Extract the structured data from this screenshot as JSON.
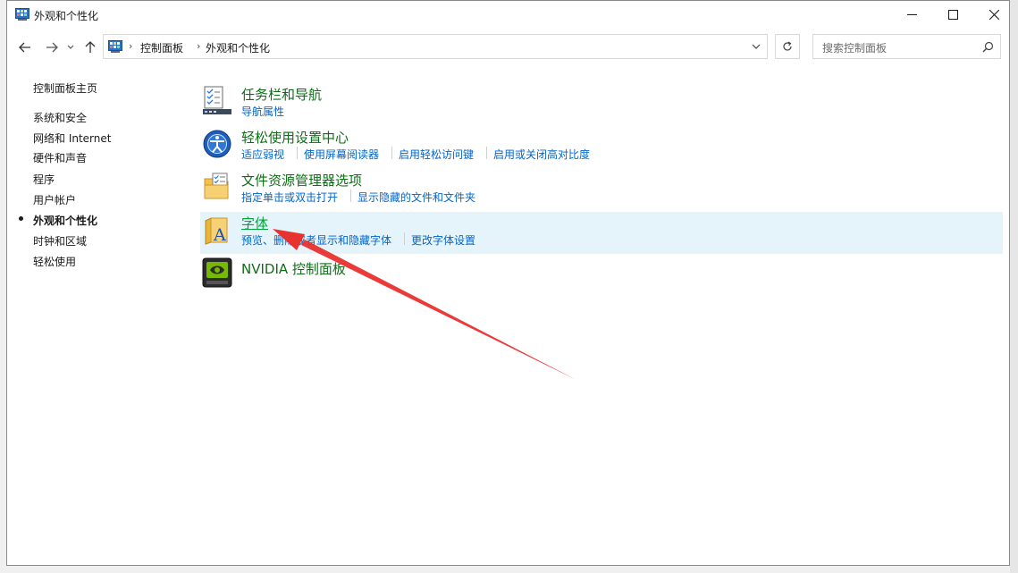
{
  "window": {
    "title": "外观和个性化",
    "controls": {
      "minimize": "minimize",
      "maximize": "maximize",
      "close": "close"
    }
  },
  "address": {
    "segments": [
      "控制面板",
      "外观和个性化"
    ]
  },
  "search": {
    "placeholder": "搜索控制面板"
  },
  "sidebar": {
    "home": "控制面板主页",
    "items": [
      {
        "label": "系统和安全",
        "active": false
      },
      {
        "label": "网络和 Internet",
        "active": false
      },
      {
        "label": "硬件和声音",
        "active": false
      },
      {
        "label": "程序",
        "active": false
      },
      {
        "label": "用户帐户",
        "active": false
      },
      {
        "label": "外观和个性化",
        "active": true
      },
      {
        "label": "时钟和区域",
        "active": false
      },
      {
        "label": "轻松使用",
        "active": false
      }
    ]
  },
  "categories": [
    {
      "title": "任务栏和导航",
      "icon": "taskbar-icon",
      "links": [
        "导航属性"
      ]
    },
    {
      "title": "轻松使用设置中心",
      "icon": "ease-of-access-icon",
      "links": [
        "适应弱视",
        "使用屏幕阅读器",
        "启用轻松访问键",
        "启用或关闭高对比度"
      ]
    },
    {
      "title": "文件资源管理器选项",
      "icon": "folder-options-icon",
      "links": [
        "指定单击或双击打开",
        "显示隐藏的文件和文件夹"
      ]
    },
    {
      "title": "字体",
      "icon": "fonts-icon",
      "links": [
        "预览、删除或者显示和隐藏字体",
        "更改字体设置"
      ],
      "highlighted": true
    },
    {
      "title": "NVIDIA 控制面板",
      "icon": "nvidia-icon",
      "links": []
    }
  ],
  "colors": {
    "category_title": "#0e6e17",
    "category_title_hover": "#00a53a",
    "link": "#0066cc",
    "highlight_row": "#e5f3fb",
    "annotation_arrow": "#e8322f"
  }
}
